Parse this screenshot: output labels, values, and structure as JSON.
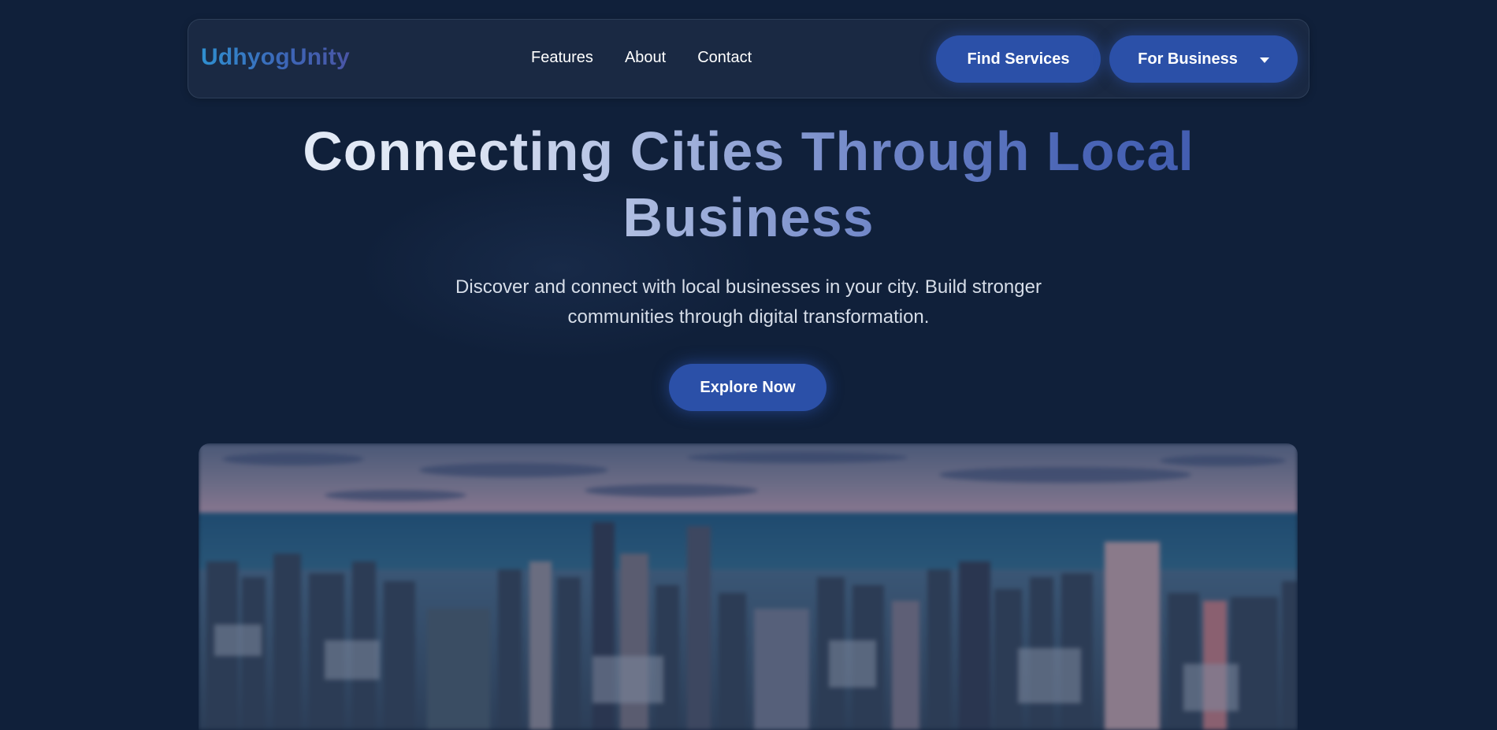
{
  "brand": {
    "name": "UdhyogUnity"
  },
  "nav": {
    "links": [
      {
        "label": "Features"
      },
      {
        "label": "About"
      },
      {
        "label": "Contact"
      }
    ],
    "find_services_label": "Find Services",
    "for_business_label": "For Business",
    "for_business_icon": "caret-down-icon"
  },
  "hero": {
    "title_line1": "Connecting Cities Through Local",
    "title_line2": "Business",
    "subtitle_line1": "Discover and connect with local businesses in your city. Build stronger",
    "subtitle_line2": "communities through digital transformation.",
    "cta_label": "Explore Now",
    "image_subject": "blurred-aerial-city-skyline"
  },
  "colors": {
    "background": "#10203a",
    "accent": "#2b50a8",
    "title_gradient_start": "#e4ebf6",
    "title_gradient_end": "#3f5aaf",
    "logo_gradient_start": "#2f8fd0",
    "logo_gradient_end": "#4a55a6"
  }
}
